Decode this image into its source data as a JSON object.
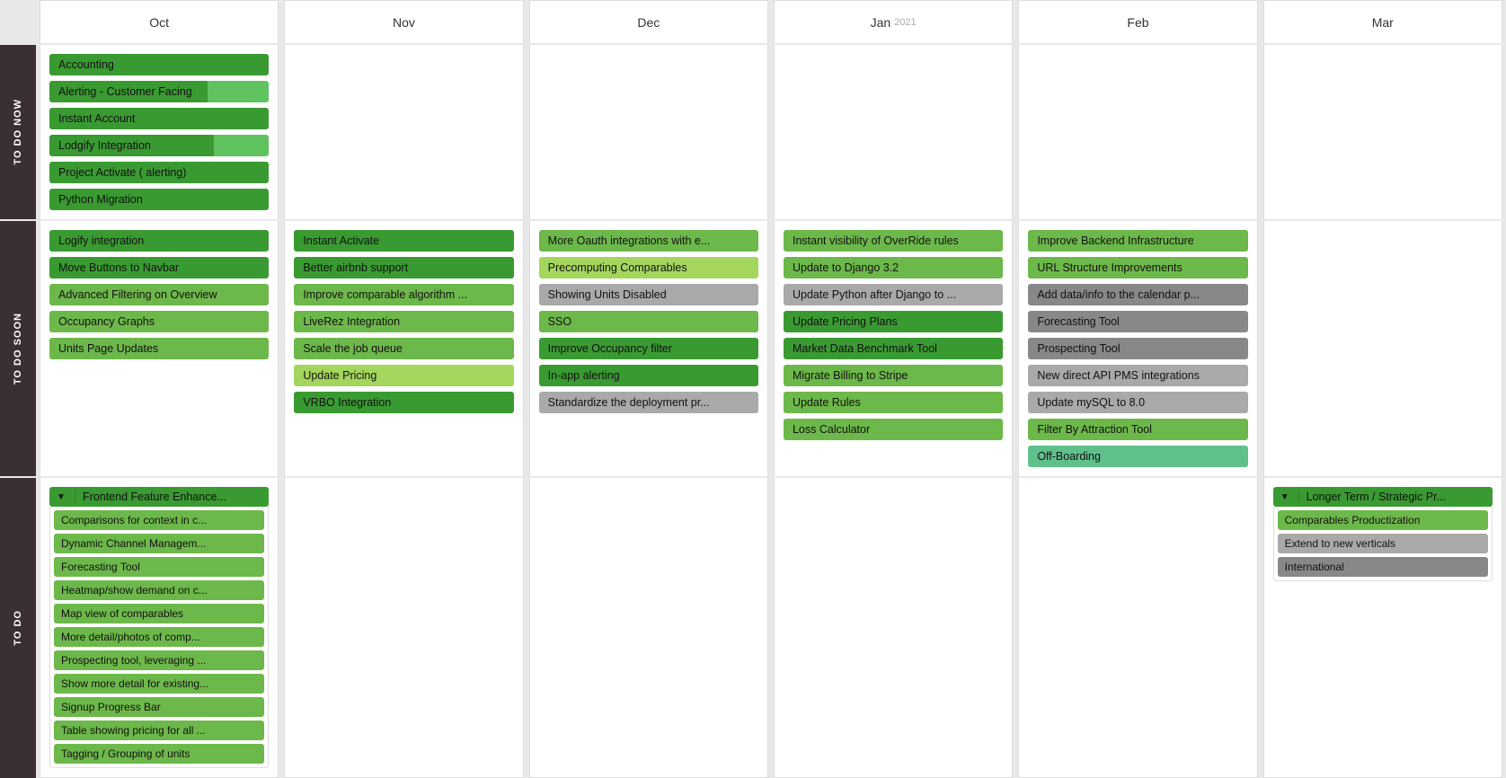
{
  "months": [
    "Oct",
    "Nov",
    "Dec",
    "Jan",
    "Feb",
    "Mar"
  ],
  "year_marker": {
    "month": "Jan",
    "year": "2021"
  },
  "lanes": [
    {
      "id": "todo-now",
      "label": "TO DO NOW",
      "cells": {
        "Oct": {
          "cards": [
            {
              "label": "Accounting",
              "color": "c-dgreen"
            },
            {
              "label": "Alerting - Customer Facing",
              "color": "c-dgreen",
              "progress": 0.72
            },
            {
              "label": "Instant Account",
              "color": "c-dgreen"
            },
            {
              "label": "Lodgify Integration",
              "color": "c-dgreen",
              "progress": 0.75
            },
            {
              "label": "Project Activate ( alerting)",
              "color": "c-dgreen"
            },
            {
              "label": "Python Migration",
              "color": "c-dgreen"
            }
          ]
        },
        "Nov": {
          "cards": []
        },
        "Dec": {
          "cards": []
        },
        "Jan": {
          "cards": []
        },
        "Feb": {
          "cards": []
        },
        "Mar": {
          "cards": []
        }
      }
    },
    {
      "id": "todo-soon",
      "label": "TO DO SOON",
      "cells": {
        "Oct": {
          "cards": [
            {
              "label": "Logify integration",
              "color": "c-dgreen"
            },
            {
              "label": "Move Buttons to Navbar",
              "color": "c-dgreen"
            },
            {
              "label": "Advanced Filtering on Overview",
              "color": "c-green"
            },
            {
              "label": "Occupancy Graphs",
              "color": "c-green"
            },
            {
              "label": "Units Page Updates",
              "color": "c-green"
            }
          ]
        },
        "Nov": {
          "cards": [
            {
              "label": "Instant Activate",
              "color": "c-dgreen"
            },
            {
              "label": "Better airbnb support",
              "color": "c-dgreen"
            },
            {
              "label": "Improve comparable algorithm ...",
              "color": "c-green"
            },
            {
              "label": "LiveRez Integration",
              "color": "c-green"
            },
            {
              "label": "Scale the job queue",
              "color": "c-green"
            },
            {
              "label": "Update Pricing",
              "color": "c-lgreen"
            },
            {
              "label": "VRBO Integration",
              "color": "c-dgreen"
            }
          ]
        },
        "Dec": {
          "cards": [
            {
              "label": "More Oauth integrations with e...",
              "color": "c-green"
            },
            {
              "label": "Precomputing Comparables",
              "color": "c-lgreen"
            },
            {
              "label": "Showing Units Disabled",
              "color": "c-gray"
            },
            {
              "label": "SSO",
              "color": "c-green"
            },
            {
              "label": "Improve Occupancy filter",
              "color": "c-dgreen"
            },
            {
              "label": "In-app alerting",
              "color": "c-dgreen"
            },
            {
              "label": "Standardize the deployment pr...",
              "color": "c-gray"
            }
          ]
        },
        "Jan": {
          "cards": [
            {
              "label": "Instant visibility of OverRide rules",
              "color": "c-green"
            },
            {
              "label": "Update to Django 3.2",
              "color": "c-green"
            },
            {
              "label": "Update Python after Django to ...",
              "color": "c-gray"
            },
            {
              "label": "Update Pricing Plans",
              "color": "c-dgreen"
            },
            {
              "label": "Market Data Benchmark Tool",
              "color": "c-dgreen"
            },
            {
              "label": "Migrate Billing to Stripe",
              "color": "c-green"
            },
            {
              "label": "Update Rules",
              "color": "c-green"
            },
            {
              "label": "Loss Calculator",
              "color": "c-green"
            }
          ]
        },
        "Feb": {
          "cards": [
            {
              "label": "Improve Backend Infrastructure",
              "color": "c-green"
            },
            {
              "label": "URL Structure Improvements",
              "color": "c-green"
            },
            {
              "label": "Add data/info to the calendar p...",
              "color": "c-dgray"
            },
            {
              "label": "Forecasting Tool",
              "color": "c-dgray"
            },
            {
              "label": "Prospecting Tool",
              "color": "c-dgray"
            },
            {
              "label": "New direct API PMS integrations",
              "color": "c-gray"
            },
            {
              "label": "Update mySQL to 8.0",
              "color": "c-gray"
            },
            {
              "label": "Filter By Attraction Tool",
              "color": "c-green"
            },
            {
              "label": "Off-Boarding",
              "color": "c-mint"
            }
          ]
        },
        "Mar": {
          "cards": []
        }
      }
    },
    {
      "id": "todo",
      "label": "TO DO",
      "cells": {
        "Oct": {
          "groups": [
            {
              "label": "Frontend Feature Enhance...",
              "color": "c-dgreen",
              "children": [
                {
                  "label": "Comparisons for context in c...",
                  "color": "c-green"
                },
                {
                  "label": "Dynamic Channel Managem...",
                  "color": "c-green"
                },
                {
                  "label": "Forecasting Tool",
                  "color": "c-green"
                },
                {
                  "label": "Heatmap/show demand on c...",
                  "color": "c-green"
                },
                {
                  "label": "Map view of comparables",
                  "color": "c-green"
                },
                {
                  "label": "More detail/photos of comp...",
                  "color": "c-green"
                },
                {
                  "label": "Prospecting tool, leveraging ...",
                  "color": "c-green"
                },
                {
                  "label": "Show more detail for existing...",
                  "color": "c-green"
                },
                {
                  "label": "Signup Progress Bar",
                  "color": "c-green"
                },
                {
                  "label": "Table showing pricing for all ...",
                  "color": "c-green"
                },
                {
                  "label": "Tagging / Grouping of units",
                  "color": "c-green"
                }
              ]
            }
          ]
        },
        "Nov": {
          "cards": []
        },
        "Dec": {
          "cards": []
        },
        "Jan": {
          "cards": []
        },
        "Feb": {
          "cards": []
        },
        "Mar": {
          "groups": [
            {
              "label": "Longer Term / Strategic Pr...",
              "color": "c-dgreen",
              "children": [
                {
                  "label": "Comparables Productization",
                  "color": "c-green"
                },
                {
                  "label": "Extend to new verticals",
                  "color": "c-gray"
                },
                {
                  "label": "International",
                  "color": "c-dgray"
                }
              ]
            }
          ]
        }
      }
    }
  ]
}
